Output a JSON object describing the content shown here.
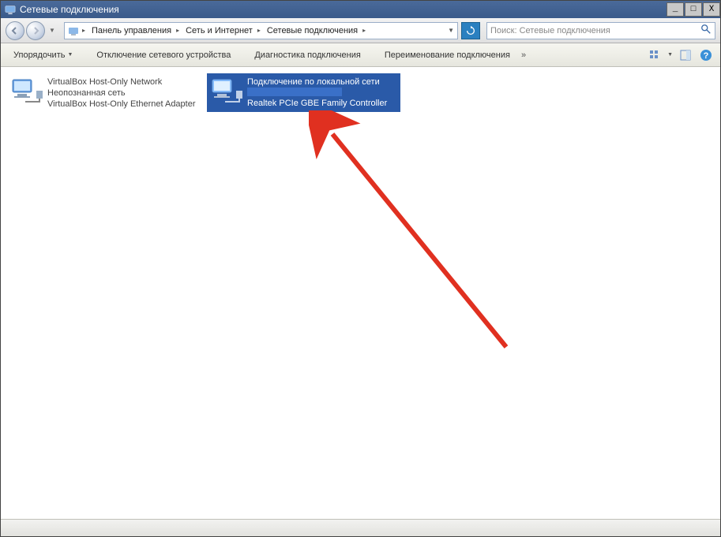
{
  "window": {
    "title": "Сетевые подключения",
    "minimize": "_",
    "maximize": "□",
    "close": "X"
  },
  "breadcrumb": {
    "items": [
      "Панель управления",
      "Сеть и Интернет",
      "Сетевые подключения"
    ]
  },
  "search": {
    "placeholder": "Поиск: Сетевые подключения"
  },
  "toolbar": {
    "organize": "Упорядочить",
    "disable": "Отключение сетевого устройства",
    "diagnose": "Диагностика подключения",
    "rename": "Переименование подключения"
  },
  "connections": [
    {
      "name": "VirtualBox Host-Only Network",
      "status": "Неопознанная сеть",
      "device": "VirtualBox Host-Only Ethernet Adapter",
      "selected": false
    },
    {
      "name": "Подключение по локальной сети",
      "status": "",
      "device": "Realtek PCIe GBE Family Controller",
      "selected": true
    }
  ],
  "colors": {
    "selection": "#2a5aa8",
    "titlebar": "#3a5a8a",
    "arrow": "#e03020"
  }
}
